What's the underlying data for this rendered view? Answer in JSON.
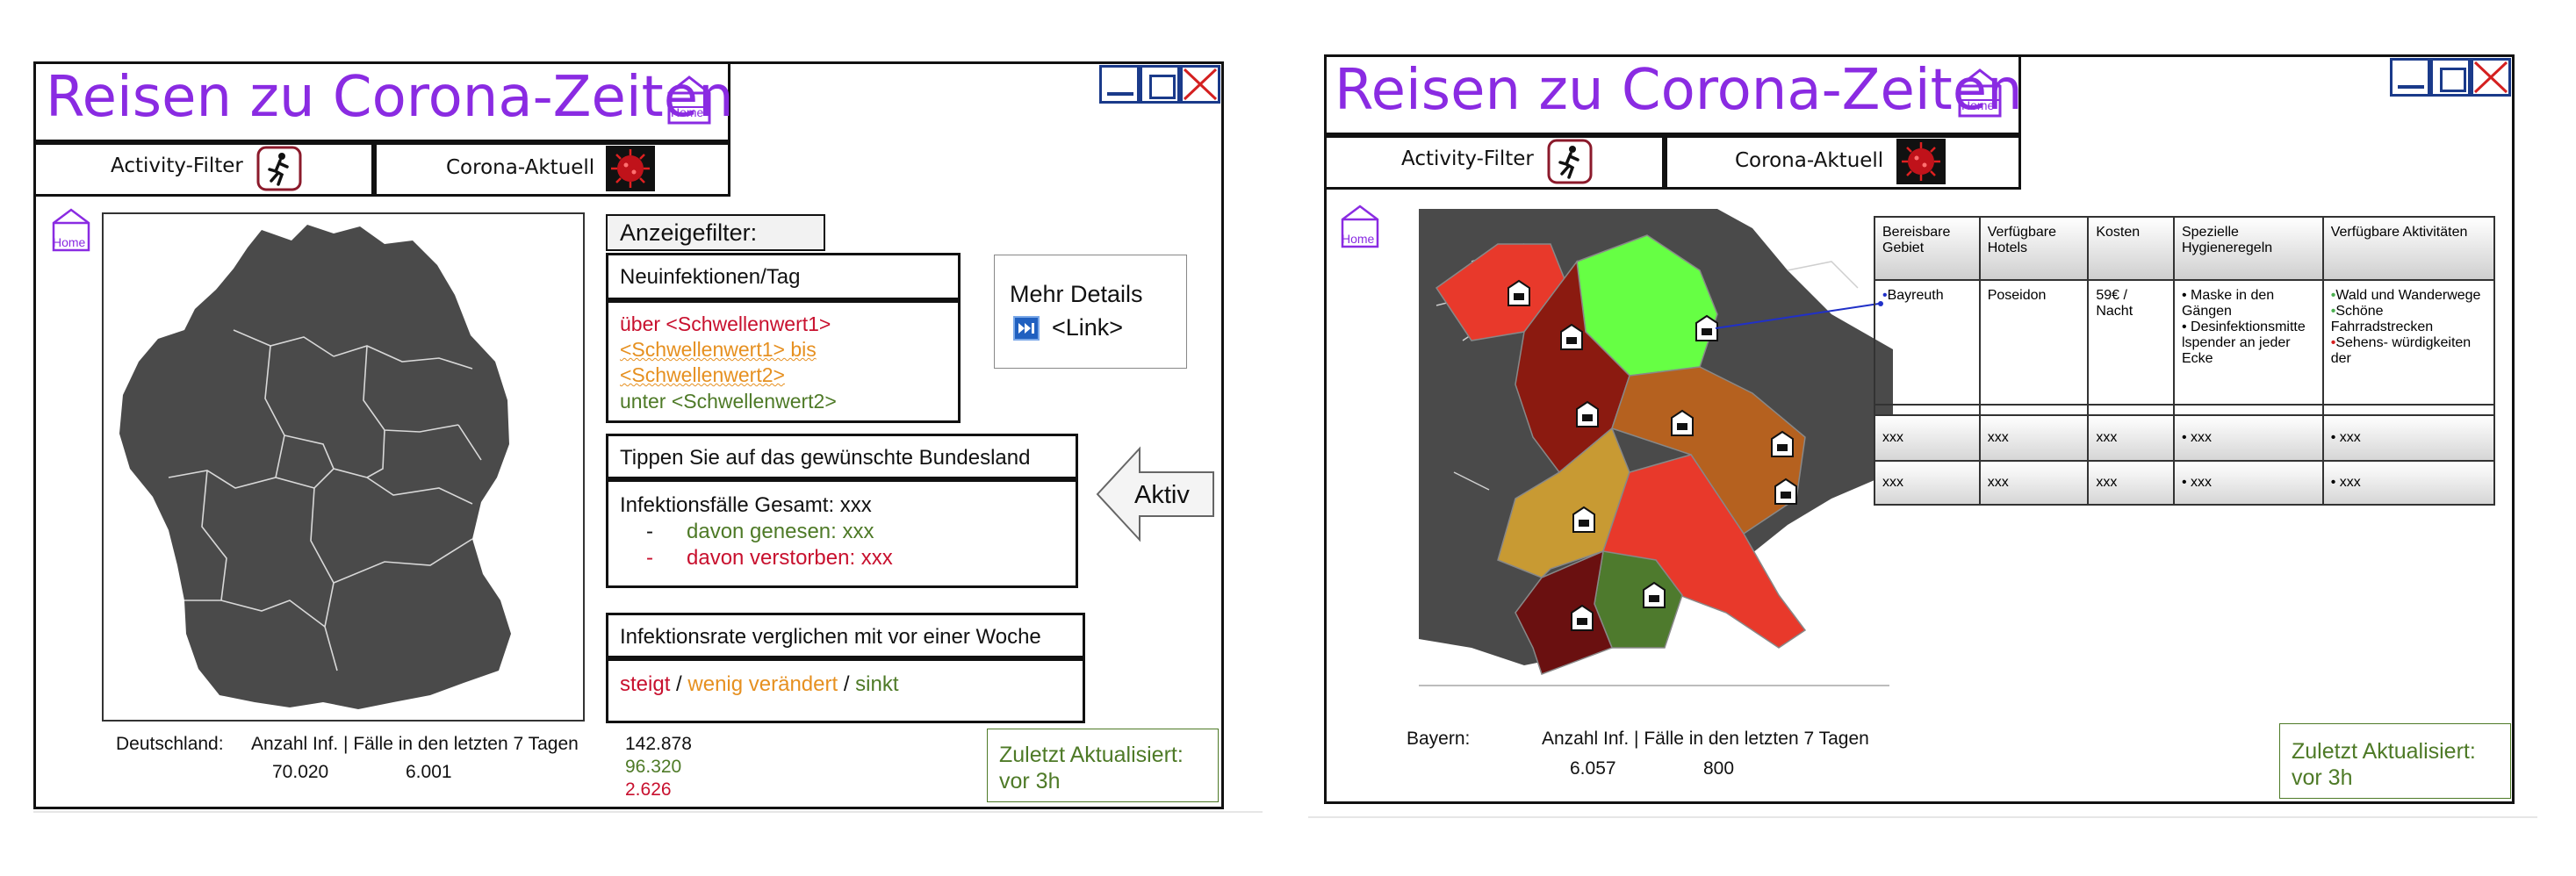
{
  "colors": {
    "title_purple": "#8a2be2",
    "infection_high": "#c8102e",
    "infection_mid": "#e69020",
    "infection_low": "#4e7a27",
    "map_gray": "#4a4a4a",
    "region_bright_green": "#66ff44",
    "region_red": "#e8392b",
    "region_dark_red": "#8b1a10",
    "region_brown_orange": "#b5611f",
    "region_olive": "#c89a33",
    "region_dark_green": "#4e7a2d",
    "region_maroon": "#6a1010",
    "window_button_blue": "#1a3a8a",
    "close_red": "#d42020",
    "link_icon_blue": "#2060c0"
  },
  "left_screen": {
    "title": "Reisen zu Corona-Zeiten",
    "home_label": "Home",
    "nav": {
      "activity_filter": "Activity-Filter",
      "corona_aktuell": "Corona-Aktuell"
    },
    "filter_header": "Anzeigefilter:",
    "neuinfektionen": {
      "title": "Neuinfektionen/Tag",
      "line1": "über <Schwellenwert1>",
      "line2": "<Schwellenwert1> bis",
      "line3": "<Schwellenwert2>",
      "line4": "unter <Schwellenwert2>"
    },
    "mehr_details": {
      "title": "Mehr Details",
      "link": "<Link>"
    },
    "tippen": "Tippen Sie auf das gewünschte Bundesland",
    "aktiv": "Aktiv",
    "infektionsfaelle": {
      "total": "Infektionsfälle Gesamt: xxx",
      "dash": "-",
      "genesen": "davon genesen: xxx",
      "verstorben": "davon verstorben: xxx"
    },
    "infektionsrate": {
      "title": "Infektionsrate verglichen mit vor einer Woche",
      "steigt": "steigt",
      "sep": "/",
      "wenig": "wenig verändert",
      "sinkt": "sinkt"
    },
    "stats": {
      "region": "Deutschland:",
      "columns": "Anzahl Inf. | Fälle in den letzten 7 Tagen",
      "anzahl": "70.020",
      "faelle": "6.001",
      "total": "142.878",
      "recovered": "96.320",
      "deaths": "2.626"
    },
    "updated": {
      "line1": "Zuletzt Aktualisiert:",
      "line2": "vor 3h"
    }
  },
  "right_screen": {
    "title": "Reisen zu Corona-Zeiten",
    "home_label": "Home",
    "nav": {
      "activity_filter": "Activity-Filter",
      "corona_aktuell": "Corona-Aktuell"
    },
    "table": {
      "headers": [
        "Bereisbare Gebiet",
        "Verfügbare Hotels",
        "Kosten",
        "Spezielle Hygieneregeln",
        "Verfügbare Aktivitäten"
      ],
      "row1": {
        "gebiet": "Bayreuth",
        "hotels": "Poseidon",
        "kosten": "59€ / Nacht",
        "hygiene": [
          "• Maske in den Gängen",
          "• Desinfektionsmitte lspender an jeder Ecke"
        ],
        "aktivitaeten": [
          "Wald und Wanderwege",
          "Schöne Fahrradstrecken",
          "Sehens- würdigkeiten der"
        ]
      },
      "row2": [
        "xxx",
        "xxx",
        "xxx",
        "• xxx",
        "• xxx"
      ],
      "row3": [
        "xxx",
        "xxx",
        "xxx",
        "• xxx",
        "• xxx"
      ]
    },
    "stats": {
      "region": "Bayern:",
      "columns": "Anzahl Inf. | Fälle in den letzten 7 Tagen",
      "anzahl": "6.057",
      "faelle": "800"
    },
    "updated": {
      "line1": "Zuletzt Aktualisiert:",
      "line2": "vor 3h"
    }
  }
}
